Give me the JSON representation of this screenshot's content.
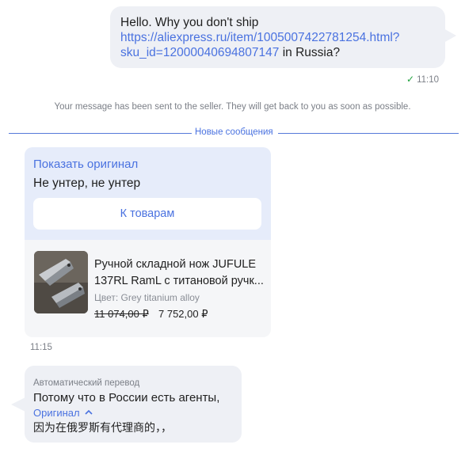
{
  "outgoing": {
    "text_before": "Hello. Why you don't ship",
    "link_line1": "https://aliexpress.ru/item/1005007422781254.html?",
    "link_line2": "sku_id=12000040694807147",
    "text_after": " in Russia?",
    "time": "11:10",
    "status_icon": "check-icon"
  },
  "system_note": "Your message has been sent to the seller. They will get back to you as soon as possible.",
  "divider": {
    "label": "Новые сообщения",
    "color": "#5579d9"
  },
  "card": {
    "show_original": "Показать оригинал",
    "message": "Не унтер, не унтер",
    "button": "К товарам",
    "product": {
      "title_line1": "Ручной складной нож JUFULE",
      "title_line2": "137RL RamL с титановой ручк...",
      "color": "Цвет: Grey titanium alloy",
      "old_price": "11 074,00 ₽",
      "new_price": "7 752,00 ₽"
    },
    "time": "11:15"
  },
  "translation": {
    "label": "Автоматический перевод",
    "text": "Потому что в России есть агенты,",
    "original_toggle": "Оригинал",
    "original_text": "因为在俄罗斯有代理商的，，"
  },
  "colors": {
    "accent": "#4a72e0",
    "bubble": "#eef0f5",
    "card_top": "#e6ecfa",
    "check": "#1fa23d"
  }
}
